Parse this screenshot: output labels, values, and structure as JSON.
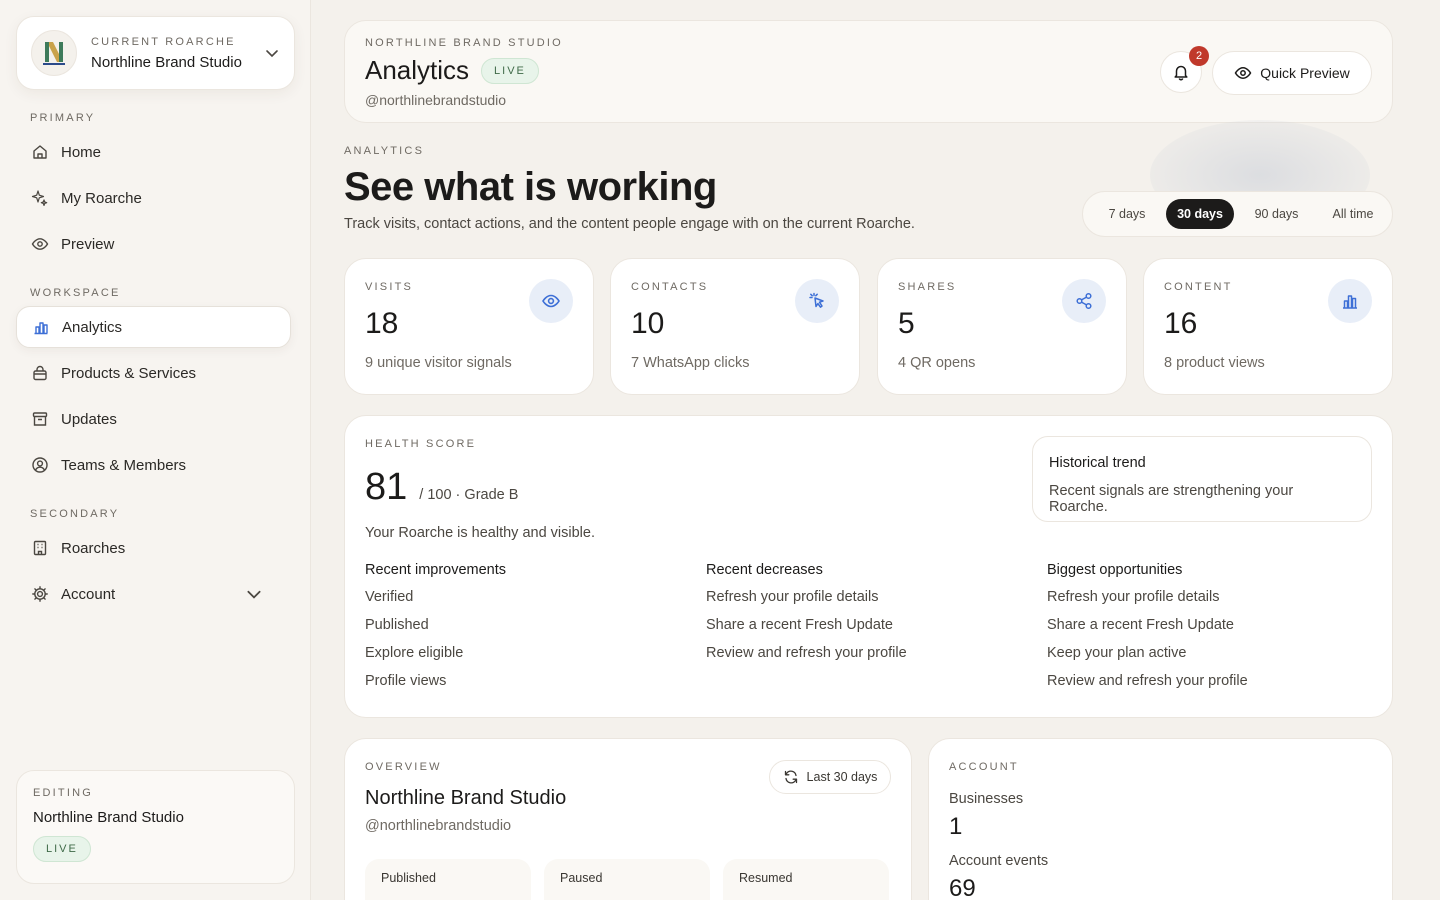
{
  "sidebar": {
    "switcher": {
      "eyebrow": "CURRENT ROARCHE",
      "name": "Northline Brand Studio"
    },
    "sections": {
      "primary": "PRIMARY",
      "workspace": "WORKSPACE",
      "secondary": "SECONDARY"
    },
    "items": {
      "home": "Home",
      "my_roarche": "My Roarche",
      "preview": "Preview",
      "analytics": "Analytics",
      "products": "Products & Services",
      "updates": "Updates",
      "teams": "Teams & Members",
      "roarches": "Roarches",
      "account": "Account"
    },
    "editing": {
      "eyebrow": "EDITING",
      "name": "Northline Brand Studio",
      "status": "LIVE"
    }
  },
  "header": {
    "eyebrow": "NORTHLINE BRAND STUDIO",
    "title": "Analytics",
    "status": "LIVE",
    "handle": "@northlinebrandstudio",
    "notifications": "2",
    "quick_preview": "Quick Preview"
  },
  "intro": {
    "eyebrow": "ANALYTICS",
    "title": "See what is working",
    "subtitle": "Track visits, contact actions, and the content people engage with on the current Roarche."
  },
  "ranges": {
    "d7": "7 days",
    "d30": "30 days",
    "d90": "90 days",
    "all": "All time",
    "selected": "30 days"
  },
  "stats": [
    {
      "label": "VISITS",
      "value": "18",
      "note": "9 unique visitor signals",
      "icon": "eye-icon"
    },
    {
      "label": "CONTACTS",
      "value": "10",
      "note": "7 WhatsApp clicks",
      "icon": "cursor-click-icon"
    },
    {
      "label": "SHARES",
      "value": "5",
      "note": "4 QR opens",
      "icon": "share-icon"
    },
    {
      "label": "CONTENT",
      "value": "16",
      "note": "8 product views",
      "icon": "bar-chart-icon"
    }
  ],
  "health": {
    "eyebrow": "HEALTH SCORE",
    "score": "81",
    "grade": "/ 100 · Grade B",
    "message": "Your Roarche is healthy and visible.",
    "trend_title": "Historical trend",
    "trend_text": "Recent signals are strengthening your Roarche.",
    "improvements": {
      "title": "Recent improvements",
      "items": [
        "Verified",
        "Published",
        "Explore eligible",
        "Profile views"
      ]
    },
    "decreases": {
      "title": "Recent decreases",
      "items": [
        "Refresh your profile details",
        "Share a recent Fresh Update",
        "Review and refresh your profile"
      ]
    },
    "opportunities": {
      "title": "Biggest opportunities",
      "items": [
        "Refresh your profile details",
        "Share a recent Fresh Update",
        "Keep your plan active",
        "Review and refresh your profile"
      ]
    }
  },
  "overview": {
    "eyebrow": "OVERVIEW",
    "name": "Northline Brand Studio",
    "handle": "@northlinebrandstudio",
    "range": "Last 30 days",
    "mini": [
      "Published",
      "Paused",
      "Resumed"
    ]
  },
  "account": {
    "eyebrow": "ACCOUNT",
    "businesses_label": "Businesses",
    "businesses_value": "1",
    "events_label": "Account events",
    "events_value": "69"
  },
  "colors": {
    "accent": "#3d6fd6",
    "live": "#3f6a48",
    "badge": "#c0392b",
    "active_tab": "#1c1b1a"
  }
}
